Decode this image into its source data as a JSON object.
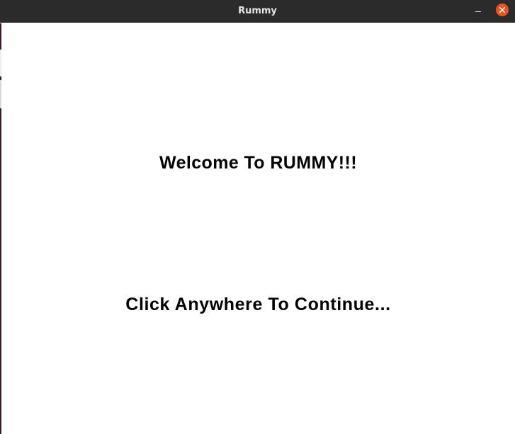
{
  "window": {
    "title": "Rummy"
  },
  "screen": {
    "welcome_text": "Welcome To RUMMY!!!",
    "prompt_text": "Click Anywhere To Continue..."
  },
  "colors": {
    "titlebar_bg": "#2b2b2b",
    "title_text": "#e6e6e6",
    "close_button": "#e95420",
    "content_bg": "#ffffff",
    "text": "#000000"
  },
  "icons": {
    "minimize": "minimize-icon",
    "close": "close-icon"
  }
}
